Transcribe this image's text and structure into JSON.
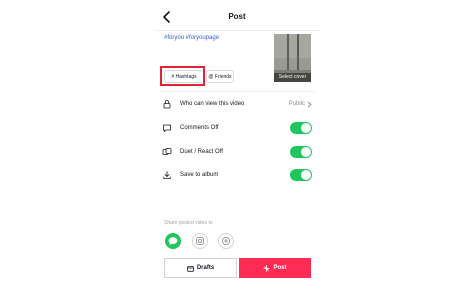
{
  "header": {
    "title": "Post"
  },
  "caption": {
    "text": "#foryou #foryoupage"
  },
  "chips": {
    "hashtags": "# Hashtags",
    "friends": "@ Friends"
  },
  "cover": {
    "label": "Select cover"
  },
  "settings": {
    "privacy_label": "Who can view this video",
    "privacy_value": "Public",
    "comments_label": "Comments Off",
    "duet_label": "Duet / React Off",
    "save_label": "Save to album",
    "comments_on": true,
    "duet_on": true,
    "save_on": true
  },
  "share": {
    "label": "Share posted video to"
  },
  "actions": {
    "drafts": "Drafts",
    "post": "Post"
  },
  "colors": {
    "accent": "#fe2c55",
    "toggle": "#20c55b",
    "highlight": "#e22432",
    "hashtag": "#3b5bd6"
  },
  "icons": {
    "back": "chevron-left-icon",
    "privacy": "lock-icon",
    "comments": "comment-icon",
    "duet": "duet-icon",
    "save": "download-icon",
    "share1": "message-icon",
    "share2": "instagram-icon",
    "share3": "add-share-icon",
    "drafts": "drafts-icon",
    "post": "sparkle-icon"
  }
}
